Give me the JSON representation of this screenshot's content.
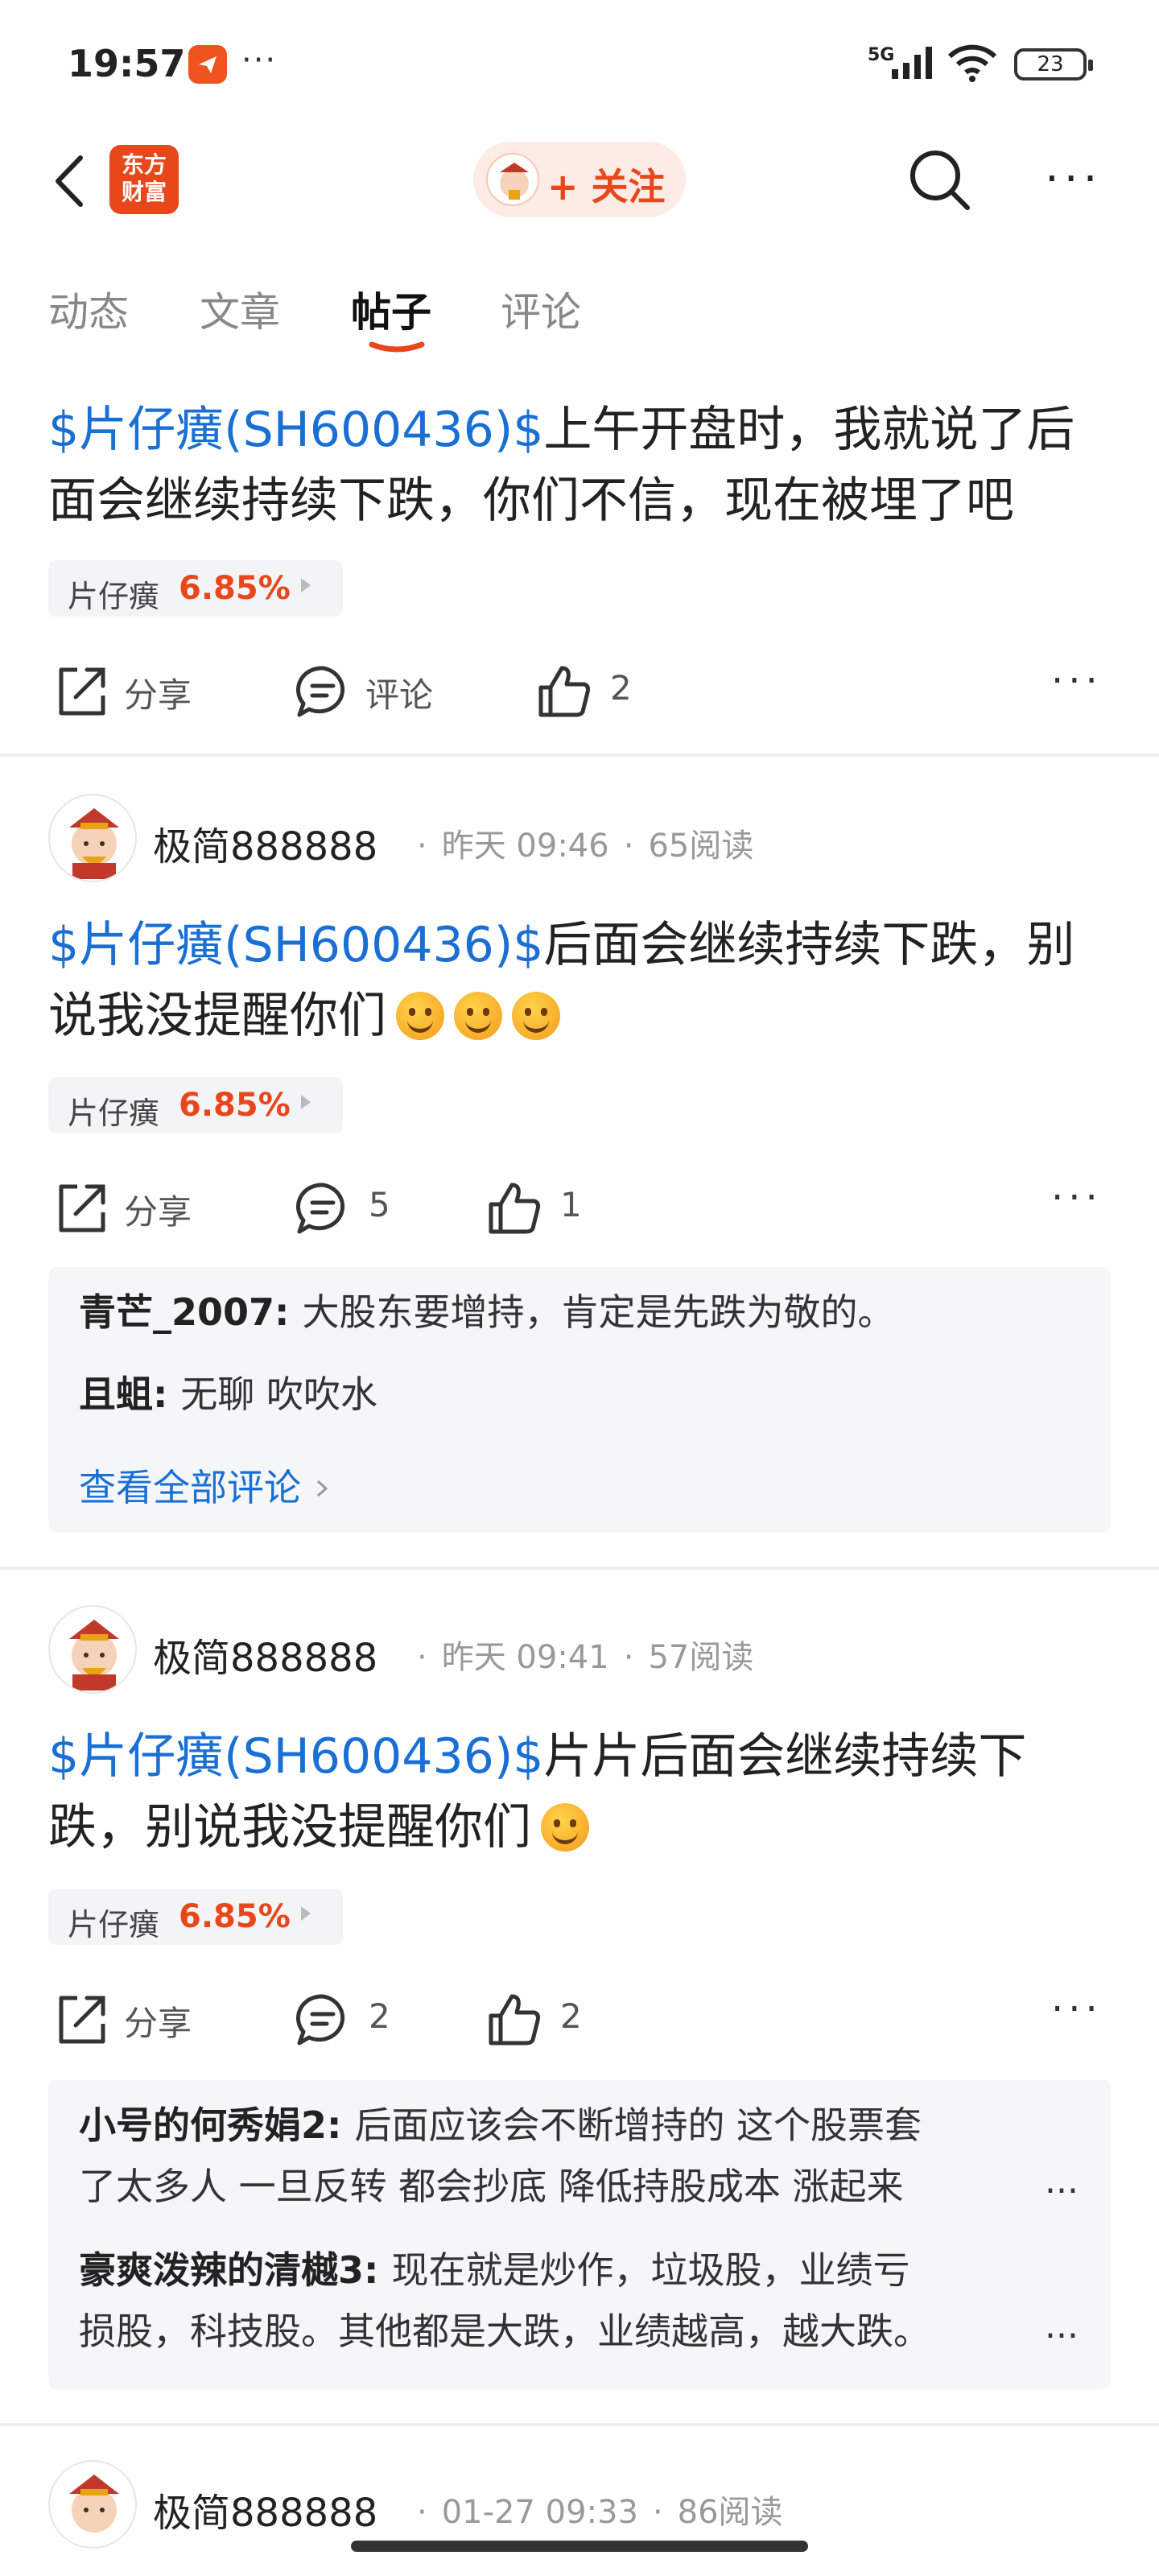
{
  "status_bar": {
    "time": "19:57",
    "dots": "···",
    "network": "5G",
    "battery": "23"
  },
  "header": {
    "logo_text": "东方\n财富",
    "follow_label": "+ 关注"
  },
  "tabs": [
    {
      "label": "动态"
    },
    {
      "label": "文章"
    },
    {
      "label": "帖子",
      "active": true
    },
    {
      "label": "评论"
    }
  ],
  "posts": [
    {
      "stock_link": "$片仔癀(SH600436)$",
      "text": "上午开盘时，我就说了后面会继续持续下跌，你们不信，现在被埋了吧",
      "tag_name": "片仔癀",
      "tag_pct": "6.85%",
      "share_label": "分享",
      "comment_label": "评论",
      "like_count": "2"
    },
    {
      "author": "极简888888",
      "time": "昨天 09:46",
      "reads": "65阅读",
      "stock_link": "$片仔癀(SH600436)$",
      "text": "后面会继续持续下跌，别说我没提醒你们",
      "tag_name": "片仔癀",
      "tag_pct": "6.85%",
      "share_label": "分享",
      "comment_count": "5",
      "like_count": "1",
      "comments": [
        {
          "user": "青芒_2007",
          "text": "大股东要增持，肯定是先跌为敬的。"
        },
        {
          "user": "且蛆",
          "text": "无聊 吹吹水"
        }
      ],
      "view_all": "查看全部评论"
    },
    {
      "author": "极简888888",
      "time": "昨天 09:41",
      "reads": "57阅读",
      "stock_link": "$片仔癀(SH600436)$",
      "text": "片片后面会继续持续下跌，别说我没提醒你们",
      "tag_name": "片仔癀",
      "tag_pct": "6.85%",
      "share_label": "分享",
      "comment_count": "2",
      "like_count": "2",
      "comments": [
        {
          "user": "小号的何秀娟2",
          "line1": "后面应该会不断增持的 这个股票套",
          "line2": "了太多人 一旦反转 都会抄底 降低持股成本 涨起来"
        },
        {
          "user": "豪爽泼辣的清樾3",
          "line1": "现在就是炒作，垃圾股，业绩亏",
          "line2": "损股，科技股。其他都是大跌，业绩越高，越大跌。"
        }
      ]
    },
    {
      "author": "极简888888",
      "time": "01-27 09:33",
      "reads": "86阅读"
    }
  ],
  "colors": {
    "accent": "#e8471c",
    "link": "#1a6fd4"
  },
  "icons": [
    "back-icon",
    "search-icon",
    "more-icon",
    "share-icon",
    "comment-icon",
    "like-icon"
  ]
}
